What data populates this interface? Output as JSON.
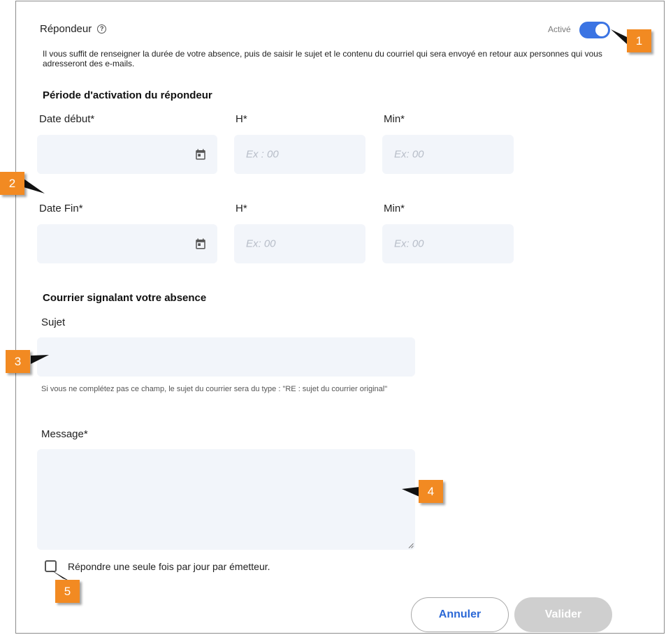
{
  "header": {
    "title": "Répondeur",
    "help_icon": "help-circle-icon",
    "toggle_label": "Activé",
    "toggle_on": true,
    "description": "Il vous suffit de renseigner la durée de votre absence, puis de saisir le sujet et le contenu du courriel qui sera envoyé en retour aux personnes qui vous adresseront des e-mails."
  },
  "activation": {
    "title": "Période d'activation du répondeur",
    "start": {
      "date_label": "Date début*",
      "hour_label": "H*",
      "min_label": "Min*",
      "hour_placeholder": "Ex : 00",
      "min_placeholder": "Ex: 00"
    },
    "end": {
      "date_label": "Date Fin*",
      "hour_label": "H*",
      "min_label": "Min*",
      "hour_placeholder": "Ex: 00",
      "min_placeholder": "Ex: 00"
    },
    "calendar_icon": "calendar-icon"
  },
  "mail": {
    "title": "Courrier signalant votre absence",
    "subject_label": "Sujet",
    "subject_hint": "Si vous ne complétez pas ce champ, le sujet du courrier sera du type : \"RE : sujet du courrier original\"",
    "message_label": "Message*",
    "once_per_day_label": "Répondre une seule fois par jour par émetteur.",
    "once_per_day_checked": false
  },
  "actions": {
    "cancel": "Annuler",
    "validate": "Valider"
  },
  "markers": [
    "1",
    "2",
    "3",
    "4",
    "5"
  ],
  "colors": {
    "accent": "#3b74e3",
    "marker": "#f28a22",
    "input_bg": "#f2f5fa",
    "disabled_button": "#cfcfcf"
  }
}
